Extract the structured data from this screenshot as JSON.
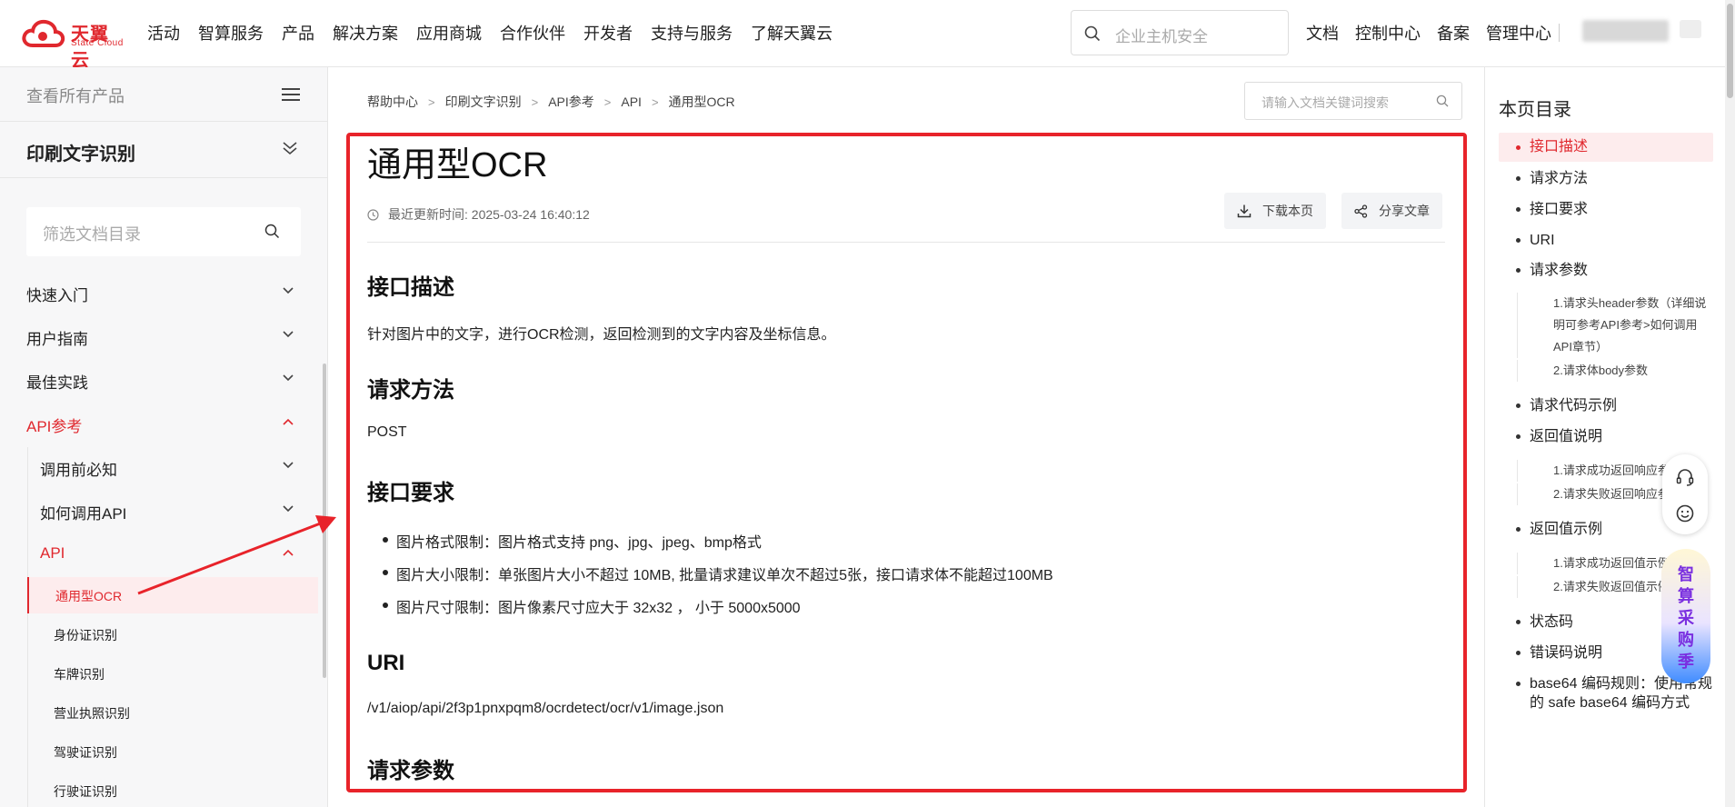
{
  "header": {
    "brand_cn": "天翼云",
    "brand_en": "State Cloud",
    "nav": [
      "活动",
      "智算服务",
      "产品",
      "解决方案",
      "应用商城",
      "合作伙伴",
      "开发者",
      "支持与服务",
      "了解天翼云"
    ],
    "search_placeholder": "企业主机安全",
    "links": [
      "文档",
      "控制中心",
      "备案",
      "管理中心"
    ]
  },
  "sidebar": {
    "all_products": "查看所有产品",
    "product": "印刷文字识别",
    "filter_placeholder": "筛选文档目录",
    "items": [
      "快速入门",
      "用户指南",
      "最佳实践",
      "API参考"
    ],
    "api_children": [
      "调用前必知",
      "如何调用API",
      "API"
    ],
    "api_leaves": [
      "通用型OCR",
      "身份证识别",
      "车牌识别",
      "营业执照识别",
      "驾驶证识别",
      "行驶证识别"
    ]
  },
  "content": {
    "breadcrumb": [
      "帮助中心",
      "印刷文字识别",
      "API参考",
      "API",
      "通用型OCR"
    ],
    "doc_search_placeholder": "请输入文档关键词搜索",
    "title": "通用型OCR",
    "updated": "最近更新时间: 2025-03-24 16:40:12",
    "download_label": "下载本页",
    "share_label": "分享文章",
    "sections": {
      "desc_title": "接口描述",
      "desc_text": "针对图片中的文字，进行OCR检测，返回检测到的文字内容及坐标信息。",
      "method_title": "请求方法",
      "method_text": "POST",
      "req_title": "接口要求",
      "req_items": [
        "图片格式限制：图片格式支持 png、jpg、jpeg、bmp格式",
        "图片大小限制：单张图片大小不超过 10MB, 批量请求建议单次不超过5张，接口请求体不能超过100MB",
        "图片尺寸限制：图片像素尺寸应大于 32x32 ， 小于 5000x5000"
      ],
      "uri_title": "URI",
      "uri_text": "/v1/aiop/api/2f3p1pnxpqm8/ocrdetect/ocr/v1/image.json",
      "params_title": "请求参数"
    }
  },
  "toc": {
    "title": "本页目录",
    "items": [
      "接口描述",
      "请求方法",
      "接口要求",
      "URI",
      "请求参数"
    ],
    "params_subs": [
      "1.请求头header参数（详细说明可参考API参考>如何调用API章节）",
      "2.请求体body参数"
    ],
    "code_example": "请求代码示例",
    "return_desc": "返回值说明",
    "return_subs": [
      "1.请求成功返回响应参数",
      "2.请求失败返回响应参数"
    ],
    "return_example": "返回值示例",
    "example_subs": [
      "1.请求成功返回值示例",
      "2.请求失败返回值示例"
    ],
    "status_code": "状态码",
    "error_code": "错误码说明",
    "base64": "base64 编码规则：使用常规的 safe base64 编码方式"
  },
  "promo": [
    "智",
    "算",
    "采",
    "购",
    "季"
  ],
  "colors": {
    "accent": "#e0282e",
    "annotation": "#e8232a"
  }
}
